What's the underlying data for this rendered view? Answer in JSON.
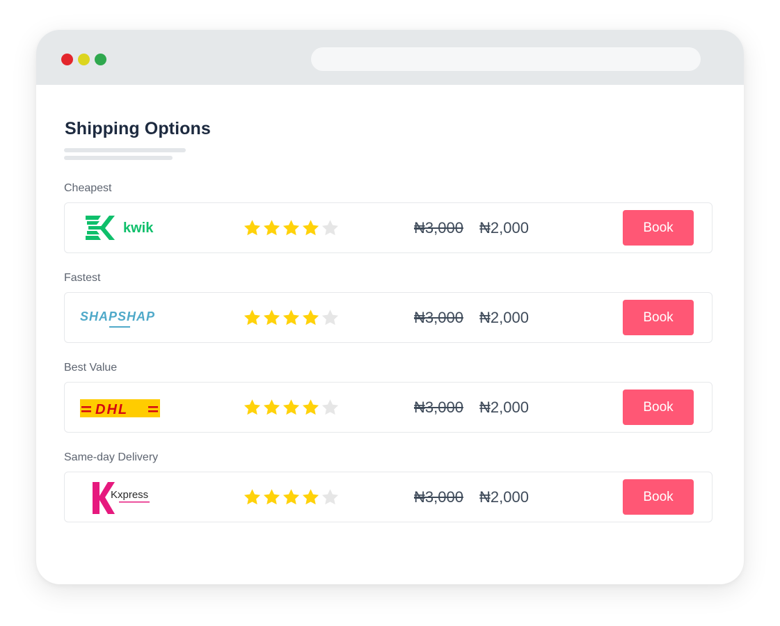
{
  "window": {
    "controls": [
      "close",
      "minimize",
      "maximize"
    ],
    "colors": {
      "close": "#e3262c",
      "minimize": "#dcd51f",
      "maximize": "#2fa84e"
    }
  },
  "page": {
    "title": "Shipping Options"
  },
  "options": [
    {
      "category": "Cheapest",
      "carrier": "kwik",
      "logo_text": "kwik",
      "logo_icon": "kwik-logo",
      "rating": 4,
      "rating_max": 5,
      "old_price": "₦3,000",
      "new_price": "₦2,000",
      "button_label": "Book"
    },
    {
      "category": "Fastest",
      "carrier": "SHAPSHAP",
      "logo_text": "SHAPSHAP",
      "logo_icon": "shapshap-logo",
      "rating": 4,
      "rating_max": 5,
      "old_price": "₦3,000",
      "new_price": "₦2,000",
      "button_label": "Book"
    },
    {
      "category": "Best Value",
      "carrier": "DHL",
      "logo_text": "DHL",
      "logo_icon": "dhl-logo",
      "rating": 4,
      "rating_max": 5,
      "old_price": "₦3,000",
      "new_price": "₦2,000",
      "button_label": "Book"
    },
    {
      "category": "Same-day Delivery",
      "carrier": "Kxpress",
      "logo_text": "Kxpress",
      "logo_icon": "kxpress-logo",
      "rating": 4,
      "rating_max": 5,
      "old_price": "₦3,000",
      "new_price": "₦2,000",
      "button_label": "Book"
    }
  ],
  "colors": {
    "accent": "#ff5775",
    "star_filled": "#ffd20a",
    "star_empty": "#e6e6e6",
    "title": "#1d2a3f",
    "kwik_green": "#0fbf6b",
    "shapshap_blue": "#4fa9c9",
    "dhl_yellow": "#ffcc00",
    "dhl_red": "#d40511",
    "kxpress_pink": "#e6197e"
  }
}
